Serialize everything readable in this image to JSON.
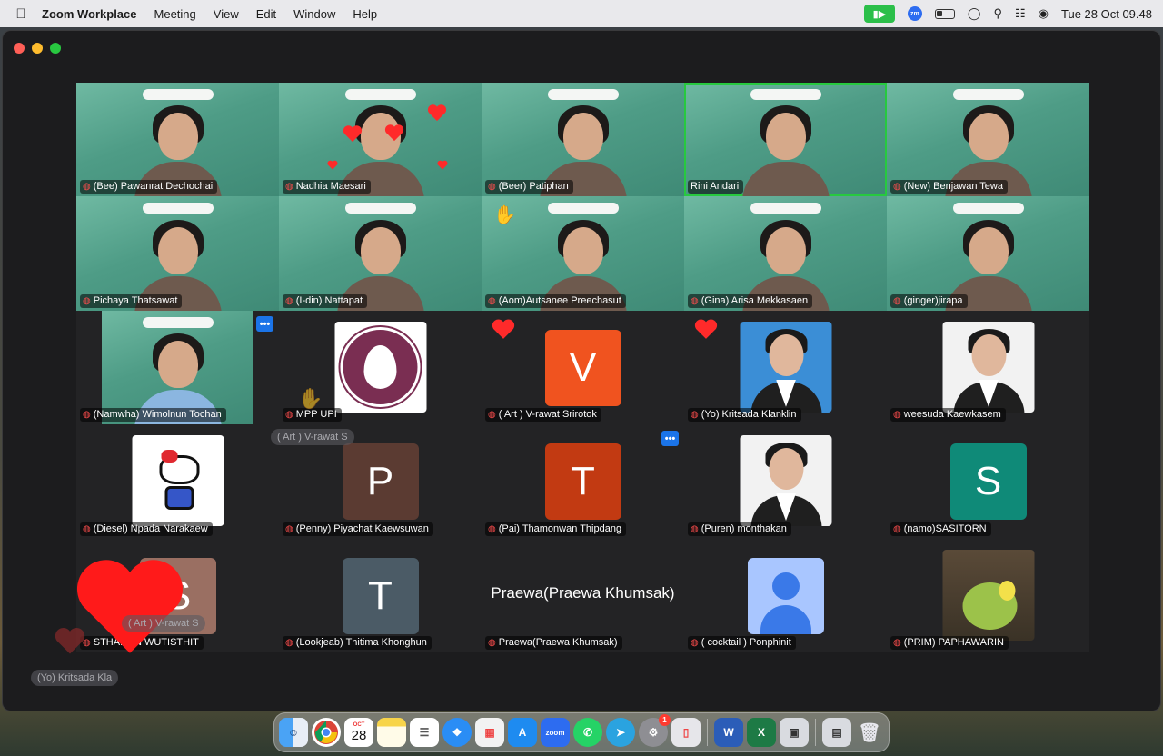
{
  "menubar": {
    "app_name": "Zoom Workplace",
    "menus": [
      "Meeting",
      "View",
      "Edit",
      "Window",
      "Help"
    ],
    "zm_badge": "zm",
    "clock": "Tue 28 Oct  09.48"
  },
  "participants": [
    {
      "name": "(Bee) Pawanrat Dechochai",
      "type": "video"
    },
    {
      "name": "Nadhia Maesari",
      "type": "video"
    },
    {
      "name": "(Beer) Patiphan",
      "type": "video"
    },
    {
      "name": "Rini Andari",
      "type": "video",
      "active": true
    },
    {
      "name": "(New) Benjawan Tewa",
      "type": "video"
    },
    {
      "name": "Pichaya Thatsawat",
      "type": "video"
    },
    {
      "name": "(I-din) Nattapat",
      "type": "video"
    },
    {
      "name": "(Aom)Autsanee Preechasut",
      "type": "video"
    },
    {
      "name": "(Gina) Arisa Mekkasaen",
      "type": "video"
    },
    {
      "name": "(ginger)jirapa",
      "type": "video"
    },
    {
      "name": "(Namwha) Wimolnun Tochan",
      "type": "video-narrow"
    },
    {
      "name": "MPP UPI",
      "type": "logo"
    },
    {
      "name": "( Art ) V-rawat Srirotok",
      "type": "letter",
      "letter": "V",
      "color": "#f0531f"
    },
    {
      "name": "(Yo) Kritsada Klanklin",
      "type": "photo",
      "photo_bg": "blue"
    },
    {
      "name": "weesuda Kaewkasem",
      "type": "photo"
    },
    {
      "name": "(Diesel) Npada Narakaew",
      "type": "kitty"
    },
    {
      "name": "(Penny) Piyachat Kaewsuwan",
      "type": "letter",
      "letter": "P",
      "color": "#5b3b32"
    },
    {
      "name": "(Pai) Thamonwan Thipdang",
      "type": "letter",
      "letter": "T",
      "color": "#c23a12"
    },
    {
      "name": "(Puren) monthakan",
      "type": "photo"
    },
    {
      "name": "(namo)SASITORN",
      "type": "letter",
      "letter": "S",
      "color": "#0f8a78"
    },
    {
      "name": "STHAPON WUTISTHIT",
      "type": "letter",
      "letter": "S",
      "color": "#9a6f62"
    },
    {
      "name": "(Lookjeab) Thitima Khonghun",
      "type": "letter",
      "letter": "T",
      "color": "#4b5b66"
    },
    {
      "name": "Praewa(Praewa Khumsak)",
      "type": "text",
      "center_text": "Praewa(Praewa Khumsak)"
    },
    {
      "name": "( cocktail ) Ponphinit",
      "type": "generic"
    },
    {
      "name": "(PRIM) PAPHAWARIN",
      "type": "caterpillar"
    }
  ],
  "overlays": {
    "ghost_art_1": "( Art ) V-rawat S",
    "ghost_art_2": "( Art ) V-rawat S",
    "ghost_yo": "(Yo) Kritsada Kla",
    "more_label": "•••"
  },
  "dock": {
    "calendar_month": "OCT",
    "calendar_day": "28",
    "zoom_label": "zoom",
    "settings_badge": "1"
  },
  "colors": {
    "active_border": "#27c93f",
    "mic_muted": "#ff4d4d",
    "more_button": "#1b74e8",
    "zoom_camera": "#2bbf4a"
  }
}
